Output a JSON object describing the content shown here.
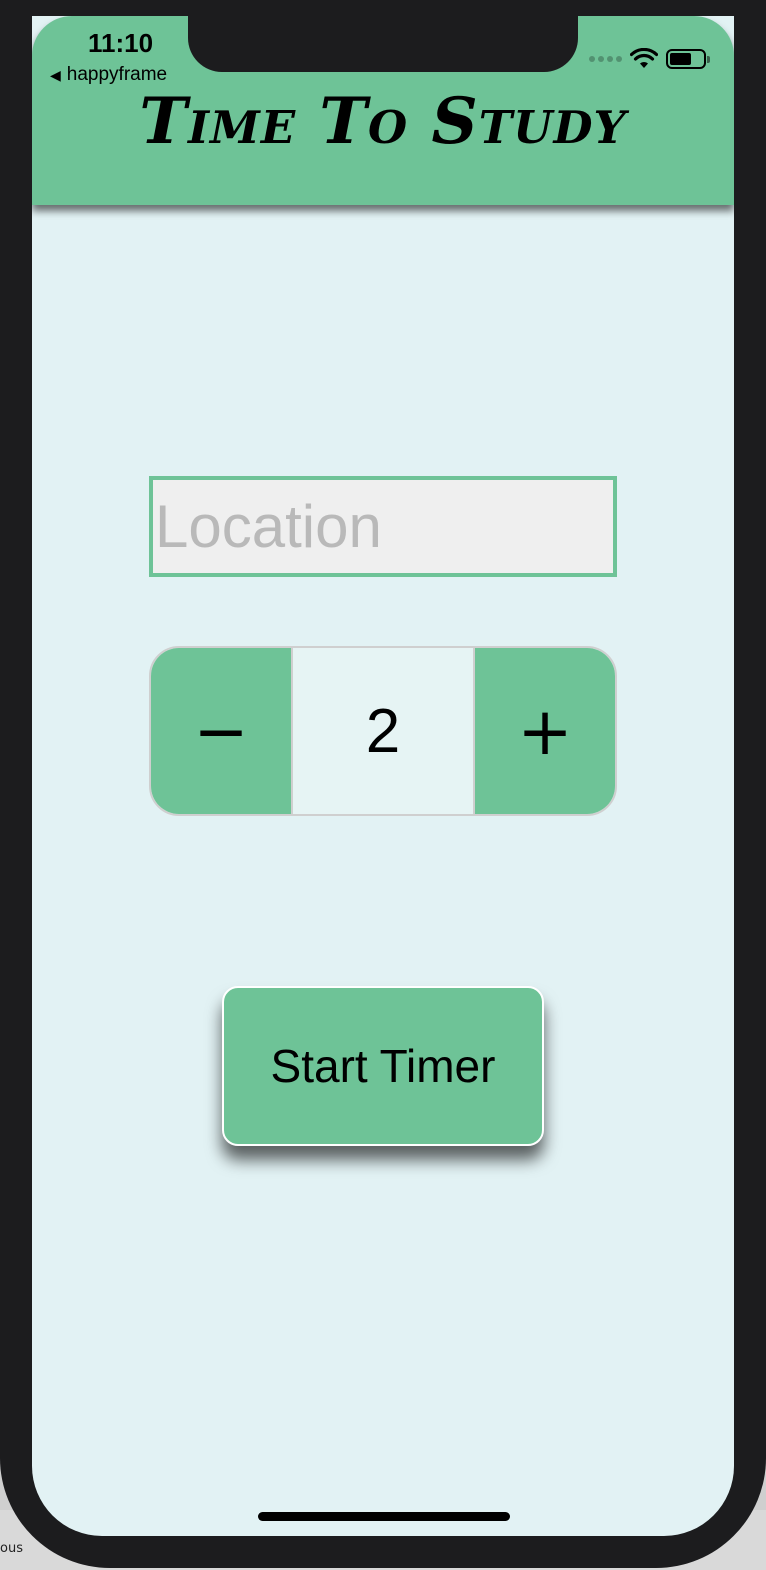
{
  "status_bar": {
    "time": "11:10",
    "back_app": "happyframe"
  },
  "header": {
    "title": "Time To Study"
  },
  "location": {
    "placeholder": "Location",
    "value": ""
  },
  "stepper": {
    "decrement_label": "−",
    "value": "2",
    "increment_label": "+"
  },
  "start_button": {
    "label": "Start Timer"
  },
  "desktop": {
    "partial_label": "ous"
  },
  "colors": {
    "accent": "#6ec397",
    "background": "#e2f2f4",
    "field_background": "#efefef",
    "frame": "#1c1c1e"
  },
  "icons": {
    "back": "back-triangle-icon",
    "signal": "cellular-signal-icon",
    "wifi": "wifi-icon",
    "battery": "battery-icon"
  },
  "battery_level": 0.65
}
